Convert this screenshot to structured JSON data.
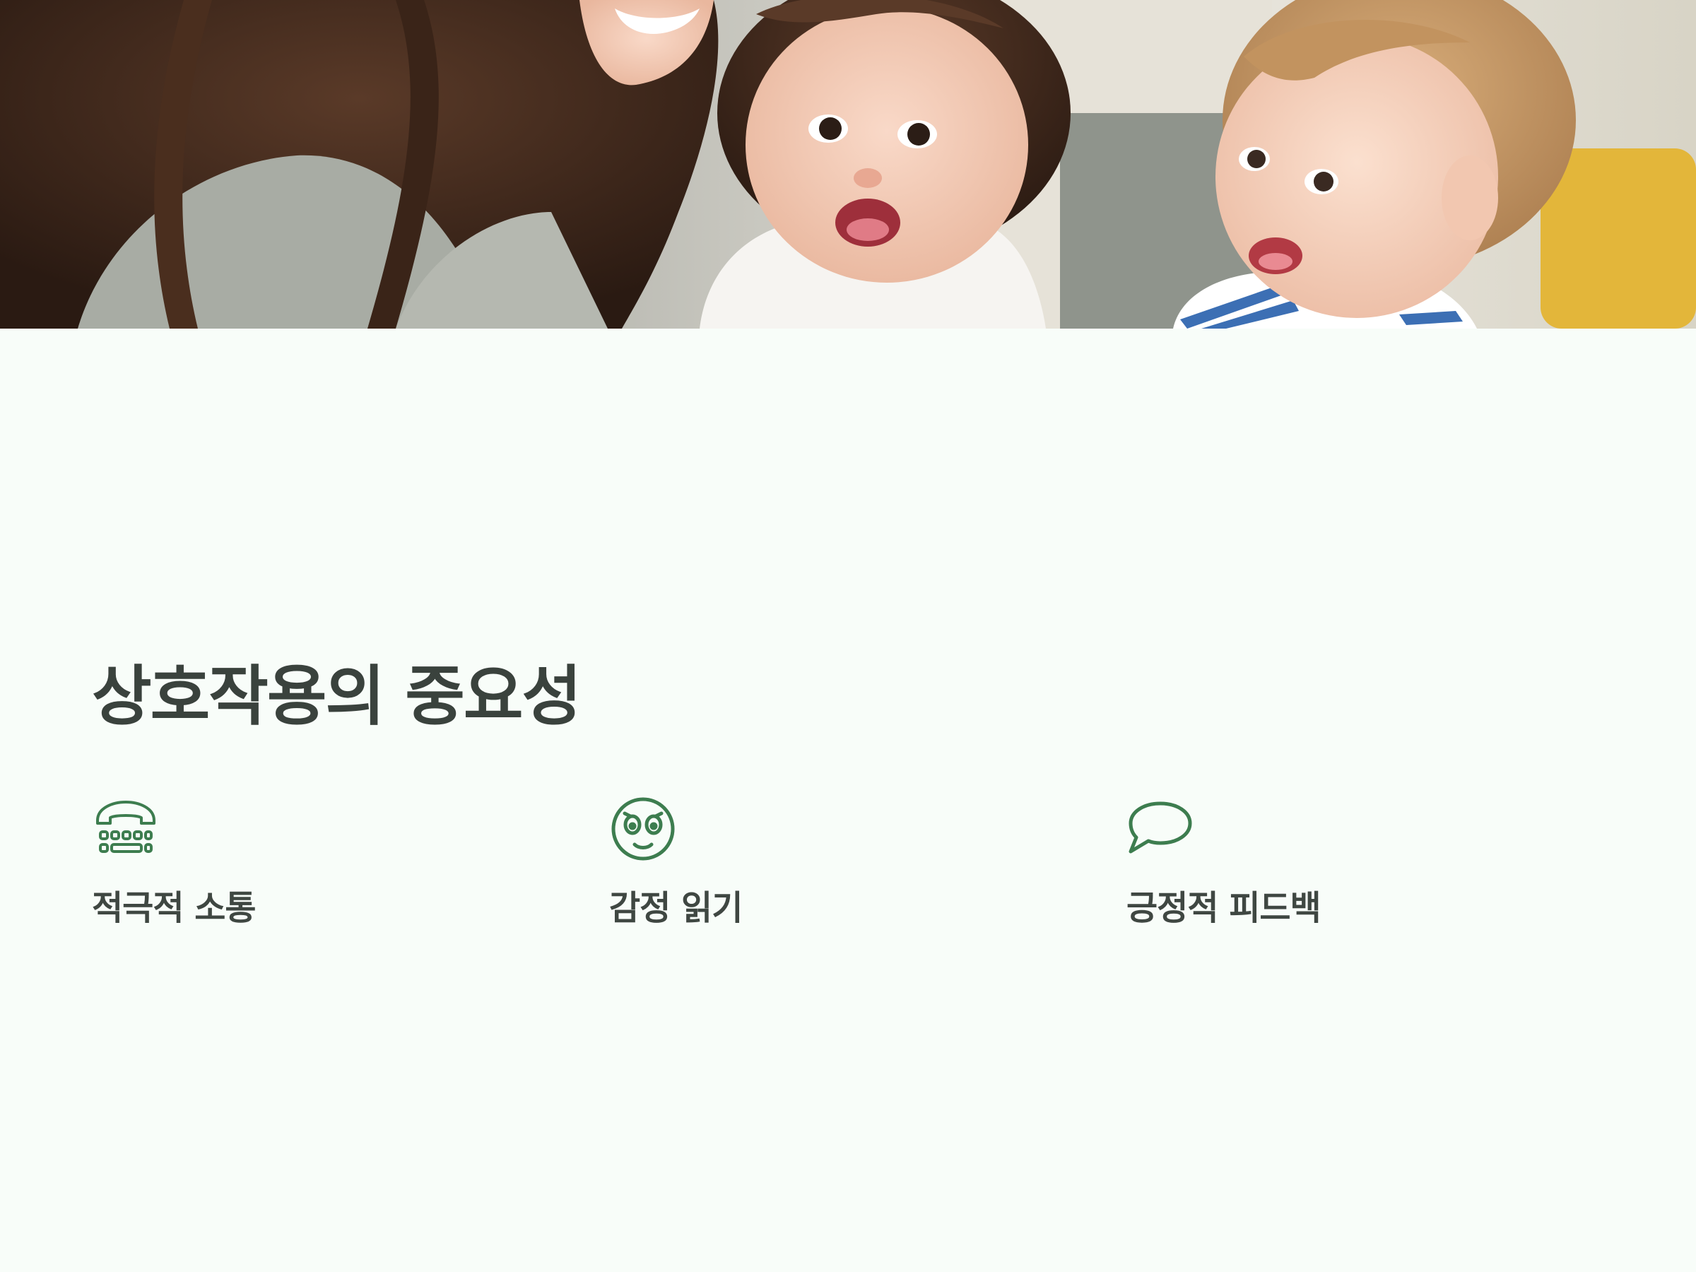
{
  "hero": {
    "image": "photo-mother-and-two-babies-smiling"
  },
  "title": "상호작용의 중요성",
  "features": [
    {
      "icon": "telephone-icon",
      "label": "적극적 소통"
    },
    {
      "icon": "face-emotion-icon",
      "label": "감정 읽기"
    },
    {
      "icon": "speech-bubble-icon",
      "label": "긍정적 피드백"
    }
  ],
  "colors": {
    "background": "#f8fdf9",
    "accent": "#3d7d4f",
    "text": "#3a423d"
  }
}
